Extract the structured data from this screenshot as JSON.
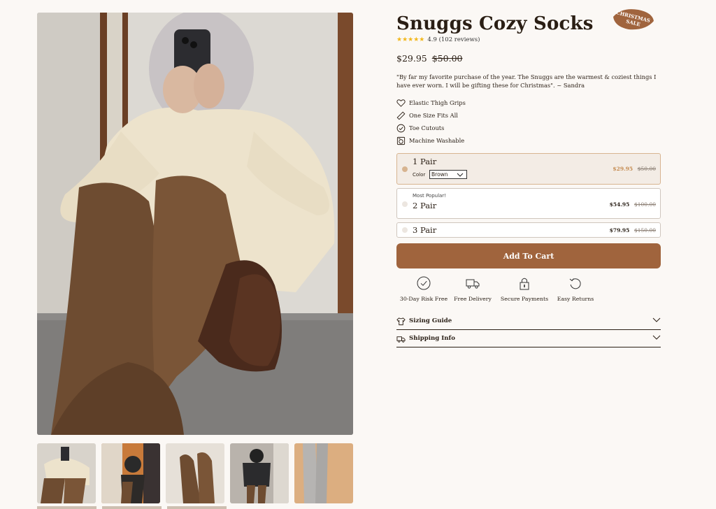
{
  "product": {
    "title": "Snuggs Cozy Socks",
    "badge_line1": "CHRISTMAS",
    "badge_line2": "SALE",
    "rating_text": "4.9 (102  reviews)",
    "price": "$29.95",
    "compare_price": "$50.00",
    "quote": "\"By far my favorite purchase of the year. The Snuggs are the warmest & coziest things I have ever worn. I will be gifting these for Christmas\". ~ Sandra",
    "features": [
      {
        "icon": "heart-icon",
        "label": "Elastic Thigh Grips"
      },
      {
        "icon": "ruler-icon",
        "label": "One Size Fits All"
      },
      {
        "icon": "check-circle-icon",
        "label": "Toe Cutouts"
      },
      {
        "icon": "washer-icon",
        "label": "Machine Washable"
      }
    ]
  },
  "options": [
    {
      "name": "1 Pair",
      "price": "$29.95",
      "compare": "$50.00",
      "selected": true,
      "color_label": "Color",
      "color_value": "Brown"
    },
    {
      "name": "2 Pair",
      "tag": "Most Popular!",
      "price": "$54.95",
      "compare": "$100.00",
      "selected": false
    },
    {
      "name": "3 Pair",
      "price": "$79.95",
      "compare": "$150.00",
      "selected": false
    }
  ],
  "cart": {
    "add_label": "Add To Cart"
  },
  "trust": [
    {
      "icon": "check-circle-icon",
      "label": "30-Day Risk Free"
    },
    {
      "icon": "truck-icon",
      "label": "Free Delivery"
    },
    {
      "icon": "lock-icon",
      "label": "Secure Payments"
    },
    {
      "icon": "return-icon",
      "label": "Easy Returns"
    }
  ],
  "accordion": [
    {
      "icon": "shirt-icon",
      "label": "Sizing Guide"
    },
    {
      "icon": "truck-icon",
      "label": "Shipping Info"
    }
  ],
  "colors": {
    "accent": "#a0643d",
    "option_selected": "#d7b490",
    "stars": "#f2b71a",
    "background": "#fbf8f5"
  }
}
